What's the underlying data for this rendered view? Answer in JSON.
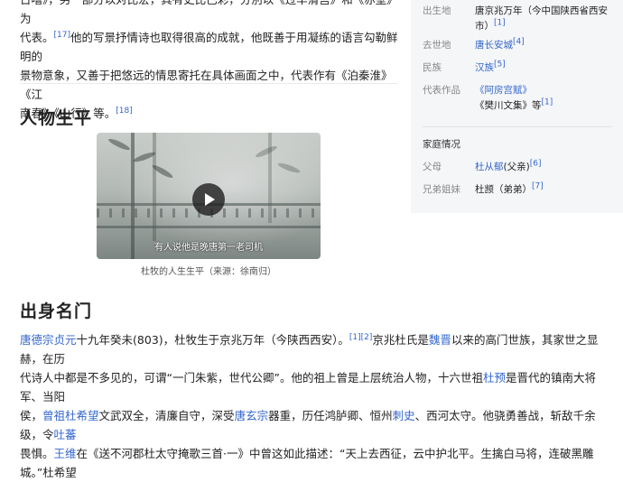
{
  "intro": {
    "line0": "日嘈》，另一部分以对比宏，其有史比已彩，分別以《过华清宫》和《赤壁》为",
    "line1_start": "代表。",
    "line1_ref": "[17]",
    "line1_rest": "他的写景抒情诗也取得很高的成就，他既善于用凝练的语言勾勒鲜明的",
    "line2": "景物意象，又善于把悠远的情思寄托在具体画面之中，代表作有《泊秦淮》《江",
    "line3": "南春》《山行》等。",
    "line3_ref": "[18]"
  },
  "sections": {
    "life_title": "人物生平",
    "origin_title": "出身名门"
  },
  "video": {
    "subtitle": "有人说他是晚唐第一老司机",
    "caption": "杜牧的人生生平（来源：徐南归）"
  },
  "origin": {
    "l1_link1": "唐德宗",
    "l1_link2": "贞元",
    "l1_t1": "十九年癸未(803)，杜牧生于京兆万年（今陕西西安）。",
    "l1_ref": "[1][2]",
    "l1_t2": "京兆杜氏是",
    "l1_link3": "魏晋",
    "l1_t3": "以来的高门世族，其家世之显赫，在历",
    "l2_t1": "代诗人中都是不多见的，可谓“一门朱紫，世代公卿”。他的祖上曾是上层统治人物，十六世祖",
    "l2_link1": "杜预",
    "l2_t2": "是晋代的镇南大将军、当阳",
    "l3_t1": "侯，",
    "l3_link1": "曾祖",
    "l3_link2": "杜希望",
    "l3_t2": "文武双全，清廉自守，深受",
    "l3_link3": "唐玄宗",
    "l3_t3": "器重，历任鸿胪卿、恒州",
    "l3_link4": "刺史",
    "l3_t4": "、西河太守。他骁勇善战，斩敌千余级，令",
    "l3_link5": "吐蕃",
    "l4_t1": "畏惧。",
    "l4_link1": "王维",
    "l4_t2": "在《送不河郡杜太守掩歌三首·一》中曾这如此描述：“天上去西征，云中护北平。生擒白马将，连破黑雕城。”杜希望"
  },
  "infobox": {
    "rows": [
      {
        "key": "出生地",
        "value": "唐京兆万年（今中国陕西省西安市）",
        "ref": "[1]"
      },
      {
        "key": "去世地",
        "value": "唐长安城",
        "ref": "[4]"
      },
      {
        "key": "民族",
        "value": "汉族",
        "ref": "[5]"
      },
      {
        "key": "代表作品",
        "value1": "《阿房宫赋》",
        "value2": "《樊川文集》",
        "value2_suffix": "等",
        "ref": "[1]"
      }
    ],
    "family_title": "家庭情况",
    "father_key": "父母",
    "father_name": "杜从郁",
    "father_rel": "(父亲)",
    "father_ref": "[6]",
    "sibling_key": "兄弟姐妹",
    "sibling_value": "杜𫖮（弟弟）",
    "sibling_ref": "[7]"
  }
}
